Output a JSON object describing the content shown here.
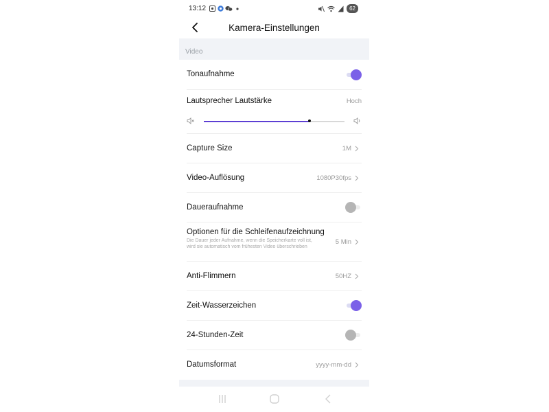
{
  "status_bar": {
    "time": "13:12",
    "battery": "62"
  },
  "header": {
    "title": "Kamera-Einstellungen"
  },
  "section": {
    "label": "Video"
  },
  "rows": {
    "tonaufnahme": {
      "label": "Tonaufnahme",
      "toggle": "on"
    },
    "lautsprecher": {
      "label": "Lautsprecher Lautstärke",
      "value": "Hoch",
      "slider_level": 0.75
    },
    "capture_size": {
      "label": "Capture Size",
      "value": "1M"
    },
    "video_aufloesung": {
      "label": "Video-Auflösung",
      "value": "1080P30fps"
    },
    "daueraufnahme": {
      "label": "Daueraufnahme",
      "toggle": "off"
    },
    "schleife": {
      "label": "Optionen für die Schleifenaufzeichnung",
      "description": "Die Dauer jeder Aufnahme, wenn die Speicherkarte voll ist, wird sie automatisch vom frühesten Video überschrieben",
      "value": "5 Min"
    },
    "anti_flimmern": {
      "label": "Anti-Flimmern",
      "value": "50HZ"
    },
    "wasserzeichen": {
      "label": "Zeit-Wasserzeichen",
      "toggle": "on"
    },
    "stunden24": {
      "label": "24-Stunden-Zeit",
      "toggle": "off"
    },
    "datumsformat": {
      "label": "Datumsformat",
      "value": "yyyy-mm-dd"
    }
  },
  "colors": {
    "accent": "#7b61e8",
    "slider": "#5d3fd3",
    "section_bg": "#f1f3f7",
    "toggle_off": "#b5b5b5",
    "value_text": "#9a9a9a"
  },
  "icons": {
    "back": "chevron-left-icon",
    "chevron": "chevron-right-icon",
    "volume_mute": "volume-mute-icon",
    "volume_up": "volume-up-icon",
    "nav_recents": "recent-apps-icon",
    "nav_home": "home-icon",
    "nav_back": "nav-back-icon"
  }
}
